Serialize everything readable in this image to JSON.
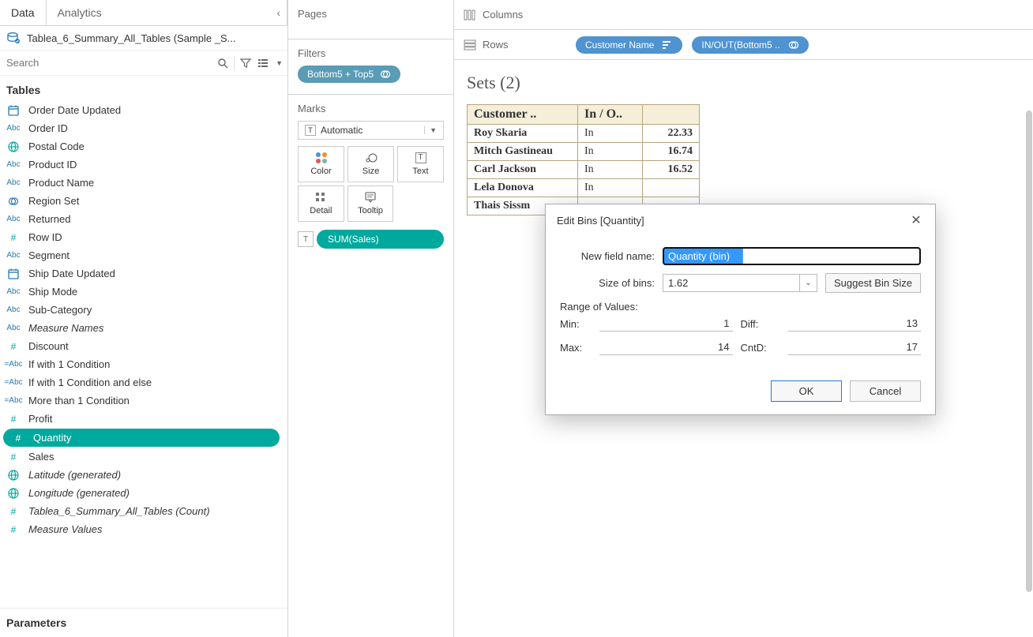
{
  "tabs": {
    "data": "Data",
    "analytics": "Analytics"
  },
  "datasource": "Tablea_6_Summary_All_Tables (Sample _S...",
  "search_placeholder": "Search",
  "tables_header": "Tables",
  "fields": [
    {
      "icon": "date",
      "label": "Order Date Updated"
    },
    {
      "icon": "abc",
      "label": "Order ID"
    },
    {
      "icon": "globe",
      "label": "Postal Code"
    },
    {
      "icon": "abc",
      "label": "Product ID"
    },
    {
      "icon": "abc",
      "label": "Product Name"
    },
    {
      "icon": "set",
      "label": "Region Set"
    },
    {
      "icon": "abc",
      "label": "Returned"
    },
    {
      "icon": "hash",
      "label": "Row ID"
    },
    {
      "icon": "abc",
      "label": "Segment"
    },
    {
      "icon": "date",
      "label": "Ship Date Updated"
    },
    {
      "icon": "abc",
      "label": "Ship Mode"
    },
    {
      "icon": "abc",
      "label": "Sub-Category"
    },
    {
      "icon": "abc",
      "label": "Measure Names",
      "italic": true
    },
    {
      "icon": "hash",
      "label": "Discount"
    },
    {
      "icon": "calc",
      "label": "If with 1 Condition"
    },
    {
      "icon": "calc",
      "label": "If with 1 Condition and else"
    },
    {
      "icon": "calc",
      "label": "More than 1 Condition"
    },
    {
      "icon": "hash",
      "label": "Profit"
    },
    {
      "icon": "hash",
      "label": "Quantity",
      "selected": true
    },
    {
      "icon": "hash",
      "label": "Sales"
    },
    {
      "icon": "globe",
      "label": "Latitude (generated)",
      "italic": true
    },
    {
      "icon": "globe",
      "label": "Longitude (generated)",
      "italic": true
    },
    {
      "icon": "hash",
      "label": "Tablea_6_Summary_All_Tables (Count)",
      "italic": true
    },
    {
      "icon": "hash",
      "label": "Measure Values",
      "italic": true
    }
  ],
  "parameters_header": "Parameters",
  "shelves": {
    "pages": "Pages",
    "filters": "Filters",
    "filter_pill": "Bottom5 + Top5",
    "marks": "Marks",
    "mark_type": "Automatic",
    "mark_buttons": {
      "color": "Color",
      "size": "Size",
      "text": "Text",
      "detail": "Detail",
      "tooltip": "Tooltip"
    },
    "text_pill": "SUM(Sales)",
    "columns": "Columns",
    "rows": "Rows",
    "row_pills": [
      "Customer Name",
      "IN/OUT(Bottom5 .."
    ]
  },
  "viz": {
    "title": "Sets (2)",
    "headers": [
      "Customer ..",
      "In / O.."
    ],
    "rows": [
      {
        "name": "Roy Skaria",
        "inout": "In",
        "val": "22.33"
      },
      {
        "name": "Mitch Gastineau",
        "inout": "In",
        "val": "16.74"
      },
      {
        "name": "Carl Jackson",
        "inout": "In",
        "val": "16.52"
      },
      {
        "name": "Lela Donova",
        "inout": "In",
        "val": ""
      },
      {
        "name": "Thais Sissm",
        "inout": "",
        "val": ""
      }
    ]
  },
  "dialog": {
    "title": "Edit Bins [Quantity]",
    "new_field_label": "New field name:",
    "new_field_value": "Quantity (bin)",
    "size_label": "Size of bins:",
    "size_value": "1.62",
    "suggest": "Suggest Bin Size",
    "range_title": "Range of Values:",
    "min_label": "Min:",
    "min_value": "1",
    "max_label": "Max:",
    "max_value": "14",
    "diff_label": "Diff:",
    "diff_value": "13",
    "cntd_label": "CntD:",
    "cntd_value": "17",
    "ok": "OK",
    "cancel": "Cancel"
  }
}
